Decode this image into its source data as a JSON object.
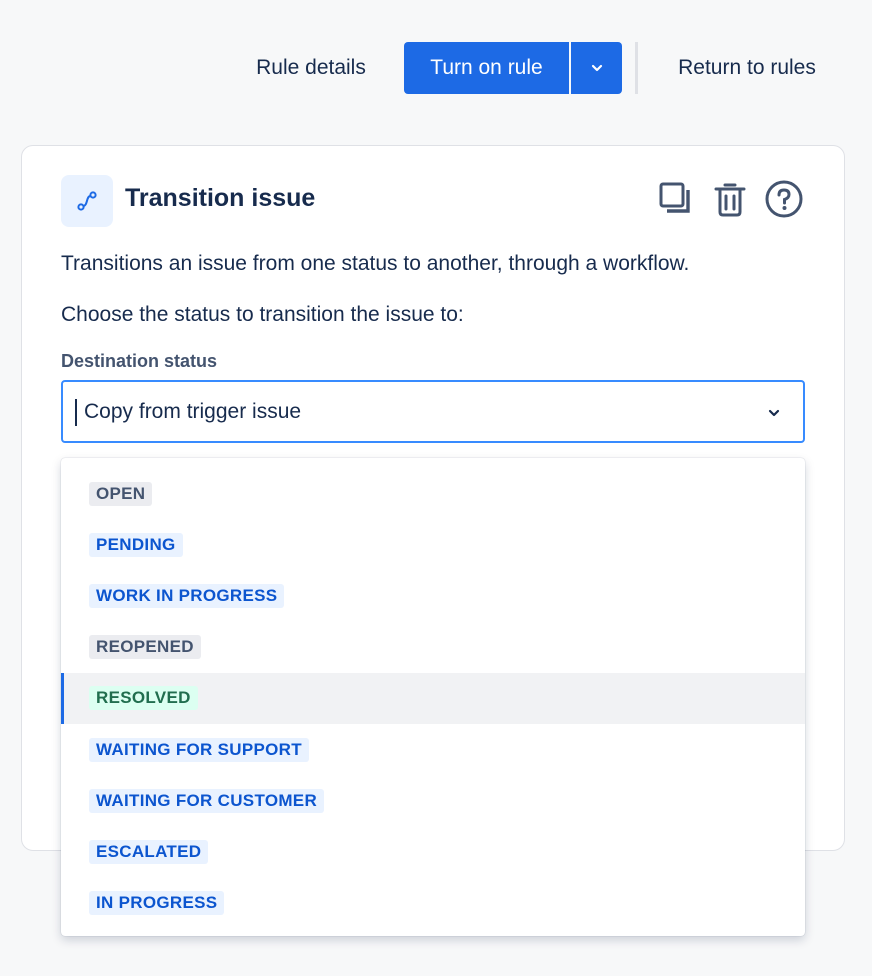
{
  "toolbar": {
    "rule_details": "Rule details",
    "turn_on_rule": "Turn on rule",
    "return_to_rules": "Return to rules"
  },
  "card": {
    "title": "Transition issue",
    "description": "Transitions an issue from one status to another, through a workflow.",
    "choose_prompt": "Choose the status to transition the issue to:",
    "field_label": "Destination status",
    "selected_value": "Copy from trigger issue",
    "icons": [
      "transition-icon",
      "copy-icon",
      "trash-icon",
      "help-icon"
    ]
  },
  "menu": {
    "options": [
      {
        "label": "OPEN",
        "style": "default"
      },
      {
        "label": "PENDING",
        "style": "inprogress"
      },
      {
        "label": "WORK IN PROGRESS",
        "style": "inprogress"
      },
      {
        "label": "REOPENED",
        "style": "default"
      },
      {
        "label": "RESOLVED",
        "style": "success",
        "highlighted": true
      },
      {
        "label": "WAITING FOR SUPPORT",
        "style": "inprogress"
      },
      {
        "label": "WAITING FOR CUSTOMER",
        "style": "inprogress"
      },
      {
        "label": "ESCALATED",
        "style": "inprogress"
      },
      {
        "label": "IN PROGRESS",
        "style": "inprogress"
      }
    ]
  },
  "colors": {
    "primary": "#1d6ae5",
    "focus_border": "#388bff",
    "lozenge_default_bg": "#ebecf0",
    "lozenge_inprogress_bg": "#e9f2ff",
    "lozenge_success_bg": "#dcfff1"
  }
}
